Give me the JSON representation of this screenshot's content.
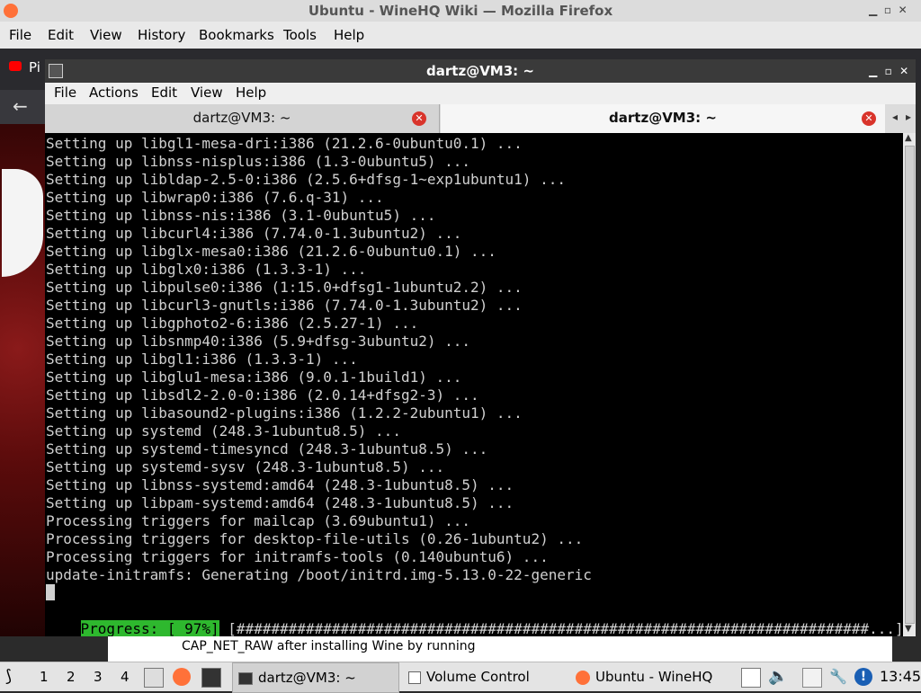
{
  "firefox": {
    "title": "Ubuntu - WineHQ Wiki — Mozilla Firefox",
    "menu": [
      "File",
      "Edit",
      "View",
      "History",
      "Bookmarks",
      "Tools",
      "Help"
    ],
    "tab_fragment": "Pi",
    "footer_text": "CAP_NET_RAW after installing Wine by running"
  },
  "terminal": {
    "title": "dartz@VM3: ~",
    "menu": [
      "File",
      "Actions",
      "Edit",
      "View",
      "Help"
    ],
    "tabs": [
      "dartz@VM3: ~",
      "dartz@VM3: ~"
    ],
    "lines": [
      "Setting up libgl1-mesa-dri:i386 (21.2.6-0ubuntu0.1) ...",
      "Setting up libnss-nisplus:i386 (1.3-0ubuntu5) ...",
      "Setting up libldap-2.5-0:i386 (2.5.6+dfsg-1~exp1ubuntu1) ...",
      "Setting up libwrap0:i386 (7.6.q-31) ...",
      "Setting up libnss-nis:i386 (3.1-0ubuntu5) ...",
      "Setting up libcurl4:i386 (7.74.0-1.3ubuntu2) ...",
      "Setting up libglx-mesa0:i386 (21.2.6-0ubuntu0.1) ...",
      "Setting up libglx0:i386 (1.3.3-1) ...",
      "Setting up libpulse0:i386 (1:15.0+dfsg1-1ubuntu2.2) ...",
      "Setting up libcurl3-gnutls:i386 (7.74.0-1.3ubuntu2) ...",
      "Setting up libgphoto2-6:i386 (2.5.27-1) ...",
      "Setting up libsnmp40:i386 (5.9+dfsg-3ubuntu2) ...",
      "Setting up libgl1:i386 (1.3.3-1) ...",
      "Setting up libglu1-mesa:i386 (9.0.1-1build1) ...",
      "Setting up libsdl2-2.0-0:i386 (2.0.14+dfsg2-3) ...",
      "Setting up libasound2-plugins:i386 (1.2.2-2ubuntu1) ...",
      "Setting up systemd (248.3-1ubuntu8.5) ...",
      "Setting up systemd-timesyncd (248.3-1ubuntu8.5) ...",
      "Setting up systemd-sysv (248.3-1ubuntu8.5) ...",
      "Setting up libnss-systemd:amd64 (248.3-1ubuntu8.5) ...",
      "Setting up libpam-systemd:amd64 (248.3-1ubuntu8.5) ...",
      "Processing triggers for mailcap (3.69ubuntu1) ...",
      "Processing triggers for desktop-file-utils (0.26-1ubuntu2) ...",
      "Processing triggers for initramfs-tools (0.140ubuntu6) ...",
      "update-initramfs: Generating /boot/initrd.img-5.13.0-22-generic"
    ],
    "progress_label": "Progress: [ 97%]",
    "progress_bar": "[#########################################################################...]",
    "progress_value": 97
  },
  "taskbar": {
    "workspaces": [
      "1",
      "2",
      "3",
      "4"
    ],
    "tasks": [
      "dartz@VM3: ~",
      "Volume Control",
      "Ubuntu - WineHQ"
    ],
    "clock": "13:45"
  },
  "colors": {
    "terminal_bg": "#000000",
    "terminal_fg": "#d0d0d0",
    "progress_bg": "#2eb82e",
    "close_red": "#d9342b"
  }
}
